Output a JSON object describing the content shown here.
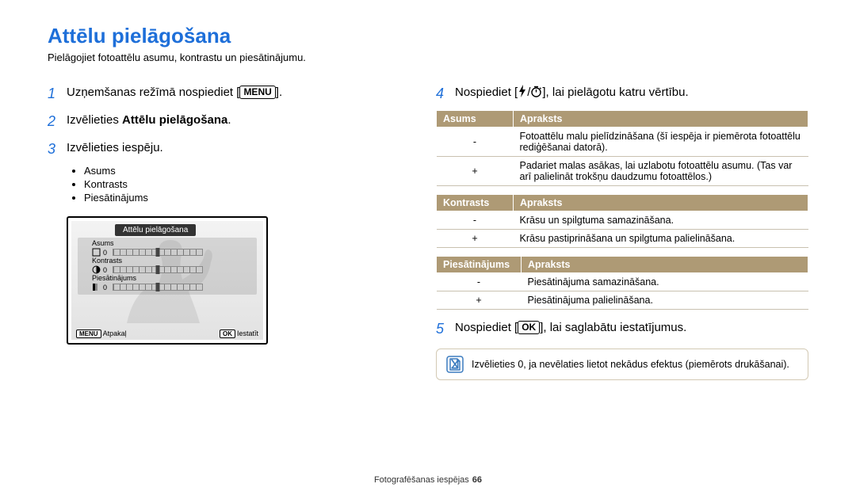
{
  "title": "Attēlu pielāgošana",
  "intro": "Pielāgojiet fotoattēlu asumu, kontrastu un piesātinājumu.",
  "steps": {
    "s1": {
      "num": "1",
      "prefix": "Uzņemšanas režīmā nospiediet [",
      "key": "MENU",
      "suffix": "]."
    },
    "s2": {
      "num": "2",
      "prefix": "Izvēlieties ",
      "bold": "Attēlu pielāgošana",
      "suffix": "."
    },
    "s3": {
      "num": "3",
      "text": "Izvēlieties iespēju."
    },
    "s4": {
      "num": "4",
      "prefix": "Nospiediet [",
      "mid": "], lai pielāgotu katru vērtību."
    },
    "s5": {
      "num": "5",
      "prefix": "Nospiediet [",
      "key": "OK",
      "suffix": "], lai saglabātu iestatījumus."
    }
  },
  "options": [
    "Asums",
    "Kontrasts",
    "Piesātinājums"
  ],
  "lcd": {
    "panel_title": "Attēlu pielāgošana",
    "row1": {
      "label": "Asums",
      "value": "0"
    },
    "row2": {
      "label": "Kontrasts",
      "value": "0"
    },
    "row3": {
      "label": "Piesātinājums",
      "value": "0"
    },
    "back_key": "MENU",
    "back_label": "Atpakaļ",
    "set_key": "OK",
    "set_label": "Iestatīt"
  },
  "table1": {
    "h1": "Asums",
    "h2": "Apraksts",
    "rows": [
      {
        "sym": "-",
        "desc": "Fotoattēlu malu pielīdzināšana (šī iespēja ir piemērota fotoattēlu rediģēšanai datorā)."
      },
      {
        "sym": "+",
        "desc": "Padariet malas asākas, lai uzlabotu fotoattēlu asumu. (Tas var arī palielināt trokšņu daudzumu fotoattēlos.)"
      }
    ]
  },
  "table2": {
    "h1": "Kontrasts",
    "h2": "Apraksts",
    "rows": [
      {
        "sym": "-",
        "desc": "Krāsu un spilgtuma samazināšana."
      },
      {
        "sym": "+",
        "desc": "Krāsu pastiprināšana un spilgtuma palielināšana."
      }
    ]
  },
  "table3": {
    "h1": "Piesātinājums",
    "h2": "Apraksts",
    "rows": [
      {
        "sym": "-",
        "desc": "Piesātinājuma samazināšana."
      },
      {
        "sym": "+",
        "desc": "Piesātinājuma palielināšana."
      }
    ]
  },
  "note": "Izvēlieties 0, ja nevēlaties lietot nekādus efektus (piemērots drukāšanai).",
  "footer": {
    "section": "Fotografēšanas iespējas",
    "page": "66"
  }
}
